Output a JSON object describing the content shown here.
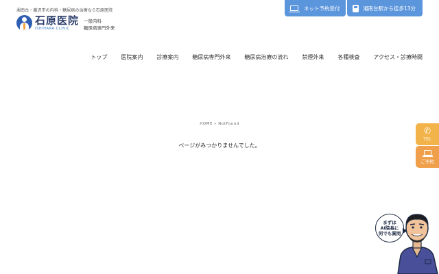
{
  "header": {
    "tagline": "湘南台・藤沢市の内科・糖尿病の治療なら石原医院",
    "logo_title": "石原医院",
    "logo_sub": "ISHIHARA CLINIC",
    "dept_line1": "一般内科",
    "dept_line2": "糖尿病専門外来",
    "reserve_label": "ネット予約受付",
    "access_label": "湘南台駅から徒歩13分"
  },
  "nav": {
    "items": [
      "トップ",
      "医院案内",
      "診療案内",
      "糖尿病専門外来",
      "糖尿病治療の流れ",
      "禁煙外来",
      "各種検査",
      "アクセス・診療時間"
    ]
  },
  "main": {
    "breadcrumb": "HOME » NotFound",
    "message": "ページがみつかりませんでした。"
  },
  "side": {
    "tel_label": "TEL",
    "reserve_label": "ご予約"
  },
  "ai": {
    "line1": "まずは",
    "line2": "AI院長に",
    "line3": "何でも質問"
  },
  "colors": {
    "brand_blue": "#5b95dc",
    "logo_navy": "#2a3c6a",
    "tel_orange": "#f2b34a",
    "reserve_orange": "#f0a04a"
  }
}
